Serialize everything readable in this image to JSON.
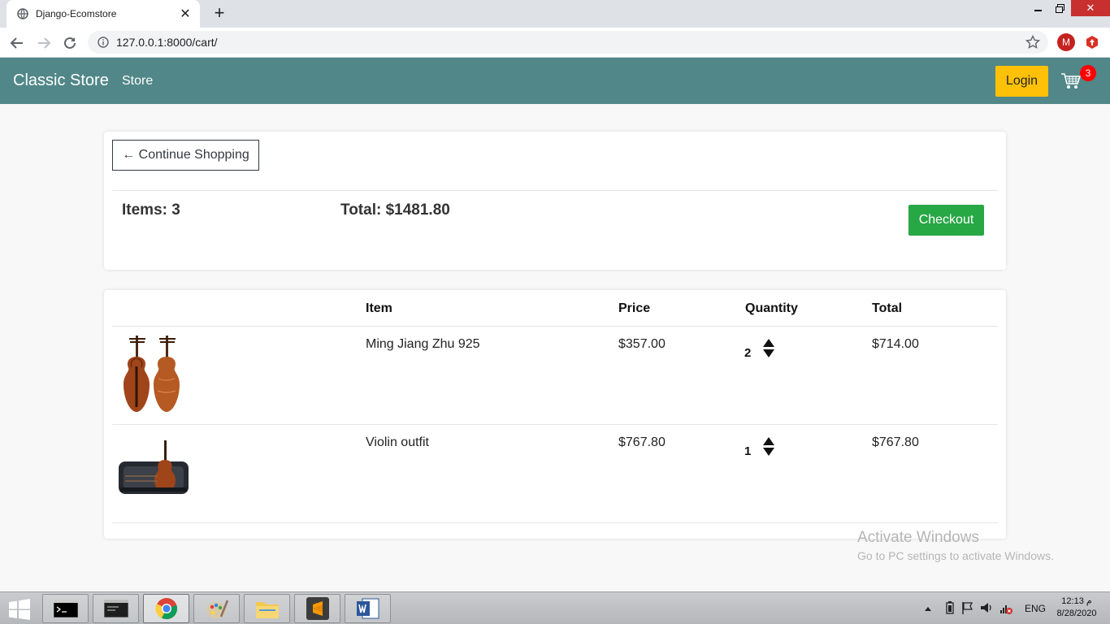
{
  "browser": {
    "tab_title": "Django-Ecomstore",
    "url": "127.0.0.1:8000/cart/",
    "profile_initial": "M"
  },
  "navbar": {
    "brand": "Classic Store",
    "store_link": "Store",
    "login_label": "Login",
    "cart_count": "3",
    "color": "#518788",
    "login_color": "#ffc107"
  },
  "summary": {
    "continue_label": "← Continue Shopping",
    "items_label": "Items:",
    "items_count": "3",
    "total_label": "Total:",
    "total_value": "$1481.80",
    "checkout_label": "Checkout",
    "checkout_color": "#28a745"
  },
  "cart": {
    "columns": [
      "",
      "Item",
      "Price",
      "Quantity",
      "Total"
    ],
    "rows": [
      {
        "image": "two-violins-image",
        "name": "Ming Jiang Zhu 925",
        "price": "$357.00",
        "quantity": "2",
        "total": "$714.00"
      },
      {
        "image": "violin-case-image",
        "name": "Violin outfit",
        "price": "$767.80",
        "quantity": "1",
        "total": "$767.80"
      }
    ]
  },
  "watermark": {
    "line1": "Activate Windows",
    "line2": "Go to PC settings to activate Windows."
  },
  "taskbar": {
    "apps": [
      "cmd-icon",
      "console-icon",
      "chrome-icon",
      "paint-icon",
      "file-explorer-icon",
      "sublime-icon",
      "word-icon"
    ],
    "language": "ENG",
    "time": "12:13 م",
    "date": "8/28/2020"
  }
}
